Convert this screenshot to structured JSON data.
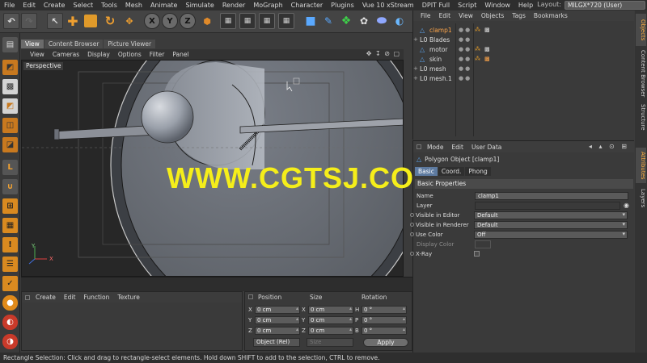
{
  "menubar": {
    "items": [
      "File",
      "Edit",
      "Create",
      "Select",
      "Tools",
      "Mesh",
      "Animate",
      "Simulate",
      "Render",
      "MoGraph",
      "Character",
      "Plugins",
      "Vue 10 xStream",
      "DPIT Full",
      "Script",
      "Window",
      "Help"
    ],
    "layout_label": "Layout:",
    "layout_value": "MILGX*720 (User)"
  },
  "toolbar": {
    "xyz": [
      "X",
      "Y",
      "Z"
    ]
  },
  "viewport": {
    "tabs": [
      "View",
      "Content Browser",
      "Picture Viewer"
    ],
    "menu": [
      "View",
      "Cameras",
      "Display",
      "Options",
      "Filter",
      "Panel"
    ],
    "camera_label": "Perspective",
    "axis_y": "Y",
    "axis_x": "X"
  },
  "watermark": "WWW.CGTSJ.COM",
  "material_manager": {
    "menu": [
      "Create",
      "Edit",
      "Function",
      "Texture"
    ]
  },
  "coordinates": {
    "headers": [
      "Position",
      "Size",
      "Rotation"
    ],
    "rows": [
      {
        "pos_label": "X",
        "pos": "0 cm",
        "size_label": "X",
        "size": "0 cm",
        "rot_label": "H",
        "rot": "0 °"
      },
      {
        "pos_label": "Y",
        "pos": "0 cm",
        "size_label": "Y",
        "size": "0 cm",
        "rot_label": "P",
        "rot": "0 °"
      },
      {
        "pos_label": "Z",
        "pos": "0 cm",
        "size_label": "Z",
        "size": "0 cm",
        "rot_label": "B",
        "rot": "0 °"
      }
    ],
    "mode": "Object (Rel)",
    "size_mode": "Size",
    "apply": "Apply"
  },
  "status_text": "Rectangle Selection: Click and drag to rectangle-select elements. Hold down SHIFT to add to the selection, CTRL to remove.",
  "object_manager": {
    "menu": [
      "File",
      "Edit",
      "View",
      "Objects",
      "Tags",
      "Bookmarks"
    ],
    "objects": [
      {
        "name": "clamp1",
        "selected": true,
        "icon": "polygon-icon"
      },
      {
        "name": "Blades",
        "selected": false,
        "icon": "null-icon"
      },
      {
        "name": "motor",
        "selected": false,
        "icon": "polygon-icon"
      },
      {
        "name": "skin",
        "selected": false,
        "icon": "polygon-icon"
      },
      {
        "name": "mesh",
        "selected": false,
        "icon": "null-icon"
      },
      {
        "name": "mesh.1",
        "selected": false,
        "icon": "null-icon"
      }
    ]
  },
  "attribute_manager": {
    "menu": [
      "Mode",
      "Edit",
      "User Data"
    ],
    "title": "Polygon Object [clamp1]",
    "tabs": [
      "Basic",
      "Coord.",
      "Phong"
    ],
    "section": "Basic Properties",
    "fields": [
      {
        "label": "Name",
        "value": "clamp1"
      },
      {
        "label": "Layer",
        "value": ""
      },
      {
        "label": "Visible in Editor",
        "value": "Default"
      },
      {
        "label": "Visible in Renderer",
        "value": "Default"
      },
      {
        "label": "Use Color",
        "value": "Off"
      },
      {
        "label": "Display Color",
        "value": ""
      },
      {
        "label": "X-Ray",
        "value": ""
      }
    ]
  },
  "side_tabs": [
    "Objects",
    "Content Browser",
    "Structure",
    "Attributes",
    "Layers"
  ],
  "colors": {
    "accent_orange": "#c8791f",
    "selection_blue": "#5d7aa0",
    "watermark_yellow": "#f5ee1a"
  }
}
